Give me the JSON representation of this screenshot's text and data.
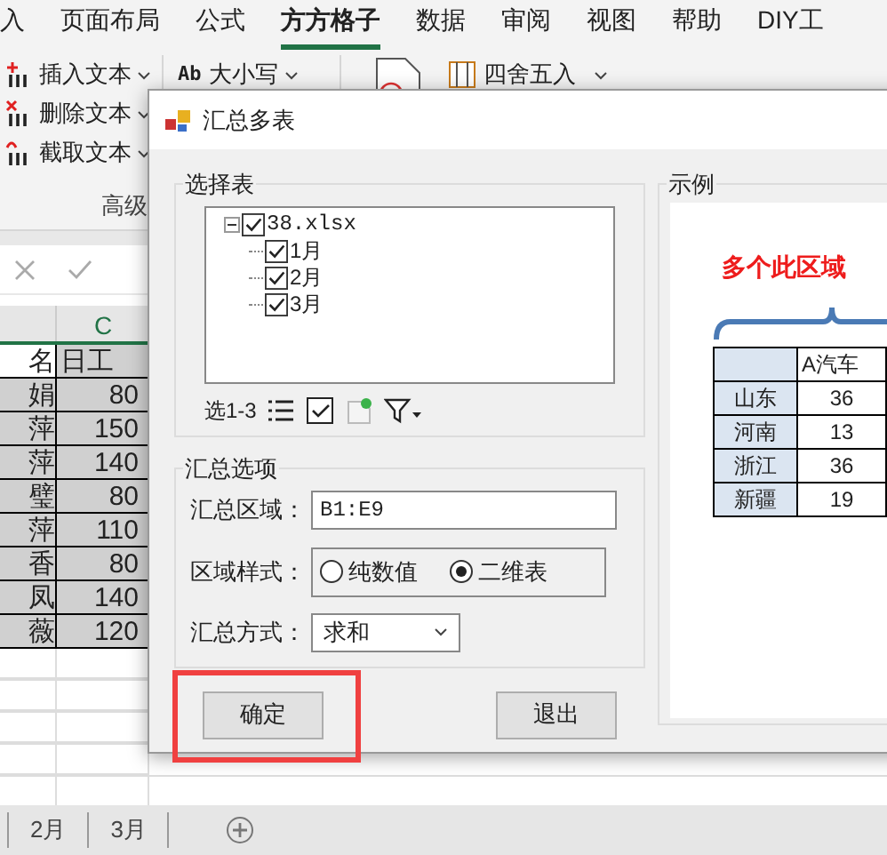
{
  "ribbon_tabs": [
    {
      "label": "入",
      "selected": false
    },
    {
      "label": "页面布局",
      "selected": false
    },
    {
      "label": "公式",
      "selected": false
    },
    {
      "label": "方方格子",
      "selected": true
    },
    {
      "label": "数据",
      "selected": false
    },
    {
      "label": "审阅",
      "selected": false
    },
    {
      "label": "视图",
      "selected": false
    },
    {
      "label": "帮助",
      "selected": false
    },
    {
      "label": "DIY工",
      "selected": false
    }
  ],
  "ribbon": {
    "text_tools": [
      {
        "kind": "insert",
        "label": "插入文本"
      },
      {
        "kind": "delete",
        "label": "删除文本"
      },
      {
        "kind": "extract",
        "label": "截取文本"
      }
    ],
    "case_button": {
      "prefix": "Ab",
      "label": "大小写"
    },
    "round_button": "四舍五入",
    "group_label": "高级"
  },
  "sheet": {
    "column_header": "C",
    "header_row": [
      "名",
      "日工"
    ],
    "rows": [
      [
        "娟",
        "80"
      ],
      [
        "萍",
        "150"
      ],
      [
        "萍",
        "140"
      ],
      [
        "璧",
        "80"
      ],
      [
        "萍",
        "110"
      ],
      [
        "香",
        "80"
      ],
      [
        "凤",
        "140"
      ],
      [
        "薇",
        "120"
      ]
    ]
  },
  "sheet_tabs": [
    {
      "label": "2月",
      "selected": false
    },
    {
      "label": "3月",
      "selected": false
    }
  ],
  "dialog": {
    "title": "汇总多表",
    "select_group": {
      "legend": "选择表",
      "tree": {
        "label": "38.xlsx",
        "checked": true,
        "expanded": true,
        "children": [
          {
            "label": "1月",
            "checked": true
          },
          {
            "label": "2月",
            "checked": true
          },
          {
            "label": "3月",
            "checked": true
          }
        ]
      },
      "selection_label": "选1-3"
    },
    "options_group": {
      "legend": "汇总选项",
      "range_label": "汇总区域：",
      "range_value": "B1:E9",
      "style_label": "区域样式：",
      "styles": [
        {
          "label": "纯数值",
          "selected": false
        },
        {
          "label": "二维表",
          "selected": true
        }
      ],
      "method_label": "汇总方式：",
      "method_value": "求和"
    },
    "buttons": [
      {
        "label": "确定",
        "highlighted": true
      },
      {
        "label": "退出",
        "highlighted": false
      }
    ],
    "example": {
      "legend": "示例",
      "caption": "多个此区域",
      "table": {
        "header": [
          "A汽车"
        ],
        "rows": [
          [
            "山东",
            "36"
          ],
          [
            "河南",
            "13"
          ],
          [
            "浙江",
            "36"
          ],
          [
            "新疆",
            "19"
          ]
        ]
      }
    }
  }
}
